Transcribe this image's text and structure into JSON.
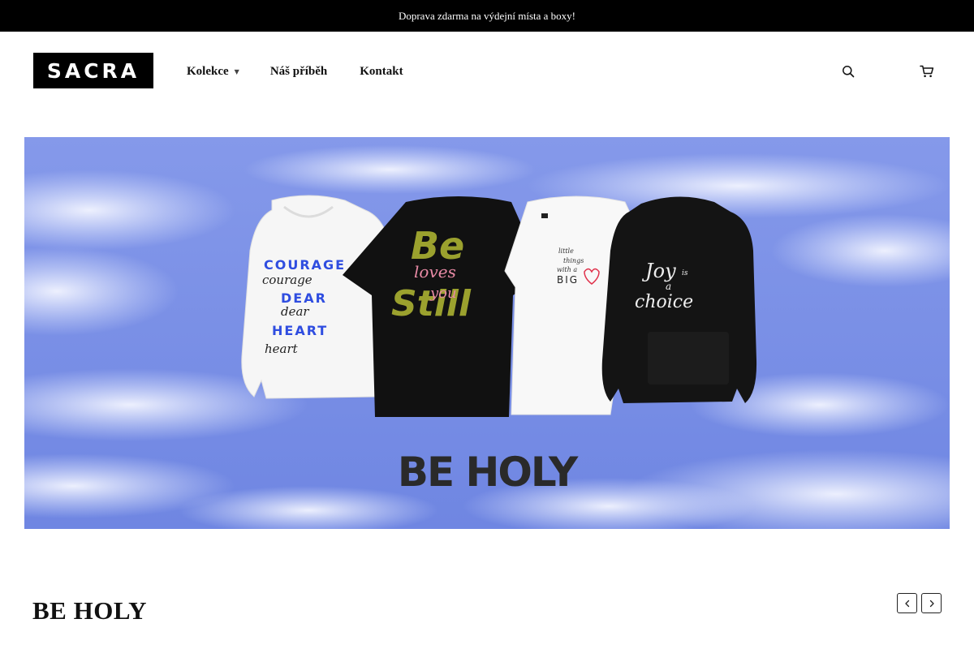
{
  "announcement": {
    "text": "Doprava zdarma na výdejní místa a boxy!"
  },
  "header": {
    "logo_text": "SACRA",
    "nav": [
      {
        "label": "Kolekce",
        "has_dropdown": true
      },
      {
        "label": "Náš příběh"
      },
      {
        "label": "Kontakt"
      }
    ],
    "icons": {
      "search": "search-icon",
      "cart": "cart-icon"
    }
  },
  "hero": {
    "headline": "BE HOLY",
    "products": [
      {
        "type": "hoodie",
        "color": "white",
        "lines": [
          "COURAGE",
          "courage",
          "DEAR",
          "dear",
          "HEART",
          "heart"
        ]
      },
      {
        "type": "t-shirt",
        "color": "black",
        "lines": [
          "Be",
          "loves",
          "Still",
          "you"
        ]
      },
      {
        "type": "t-shirt",
        "color": "white",
        "lines": [
          "little",
          "things",
          "with a",
          "BIG"
        ]
      },
      {
        "type": "hoodie",
        "color": "black",
        "lines": [
          "Joy",
          "is",
          "a",
          "choice"
        ]
      }
    ],
    "colors": {
      "sky": "#7a90e6",
      "accent_blue": "#2f4de0",
      "olive": "#9ba12e",
      "heart_red": "#e0304a"
    }
  },
  "section": {
    "title": "BE HOLY"
  },
  "carousel": {
    "prev": "chevron-left-icon",
    "next": "chevron-right-icon"
  }
}
